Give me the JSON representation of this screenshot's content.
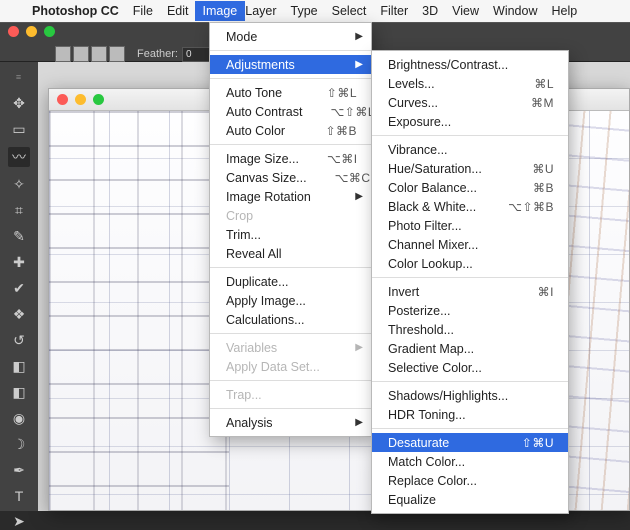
{
  "menubar": {
    "app_name": "Photoshop CC",
    "items": [
      "File",
      "Edit",
      "Image",
      "Layer",
      "Type",
      "Select",
      "Filter",
      "3D",
      "View",
      "Window",
      "Help"
    ],
    "open_index": 2
  },
  "options_bar": {
    "feather_label": "Feather:",
    "feather_value": "0"
  },
  "toolbox": {
    "tools": [
      {
        "name": "move-tool",
        "glyph": "✥"
      },
      {
        "name": "marquee-tool",
        "glyph": "▭"
      },
      {
        "name": "lasso-tool",
        "glyph": "〰",
        "selected": true
      },
      {
        "name": "magic-wand-tool",
        "glyph": "✧"
      },
      {
        "name": "crop-tool",
        "glyph": "⌗"
      },
      {
        "name": "eyedropper-tool",
        "glyph": "✎"
      },
      {
        "name": "healing-brush-tool",
        "glyph": "✚"
      },
      {
        "name": "brush-tool",
        "glyph": "✔"
      },
      {
        "name": "clone-stamp-tool",
        "glyph": "❖"
      },
      {
        "name": "history-brush-tool",
        "glyph": "↺"
      },
      {
        "name": "eraser-tool",
        "glyph": "◧"
      },
      {
        "name": "gradient-tool",
        "glyph": "◧"
      },
      {
        "name": "blur-tool",
        "glyph": "◉"
      },
      {
        "name": "dodge-tool",
        "glyph": "☽"
      },
      {
        "name": "pen-tool",
        "glyph": "✒"
      },
      {
        "name": "type-tool",
        "glyph": "T"
      },
      {
        "name": "path-select-tool",
        "glyph": "➤"
      }
    ]
  },
  "document": {
    "title": ""
  },
  "image_menu": [
    {
      "label": "Mode",
      "arrow": true
    },
    {
      "sep": true
    },
    {
      "label": "Adjustments",
      "arrow": true,
      "highlight": true
    },
    {
      "sep": true
    },
    {
      "label": "Auto Tone",
      "shortcut": "⇧⌘L"
    },
    {
      "label": "Auto Contrast",
      "shortcut": "⌥⇧⌘L"
    },
    {
      "label": "Auto Color",
      "shortcut": "⇧⌘B"
    },
    {
      "sep": true
    },
    {
      "label": "Image Size...",
      "shortcut": "⌥⌘I"
    },
    {
      "label": "Canvas Size...",
      "shortcut": "⌥⌘C"
    },
    {
      "label": "Image Rotation",
      "arrow": true
    },
    {
      "label": "Crop",
      "disabled": true
    },
    {
      "label": "Trim..."
    },
    {
      "label": "Reveal All"
    },
    {
      "sep": true
    },
    {
      "label": "Duplicate..."
    },
    {
      "label": "Apply Image..."
    },
    {
      "label": "Calculations..."
    },
    {
      "sep": true
    },
    {
      "label": "Variables",
      "arrow": true,
      "disabled": true
    },
    {
      "label": "Apply Data Set...",
      "disabled": true
    },
    {
      "sep": true
    },
    {
      "label": "Trap...",
      "disabled": true
    },
    {
      "sep": true
    },
    {
      "label": "Analysis",
      "arrow": true
    }
  ],
  "adjustments_menu": [
    {
      "label": "Brightness/Contrast..."
    },
    {
      "label": "Levels...",
      "shortcut": "⌘L"
    },
    {
      "label": "Curves...",
      "shortcut": "⌘M"
    },
    {
      "label": "Exposure..."
    },
    {
      "sep": true
    },
    {
      "label": "Vibrance..."
    },
    {
      "label": "Hue/Saturation...",
      "shortcut": "⌘U"
    },
    {
      "label": "Color Balance...",
      "shortcut": "⌘B"
    },
    {
      "label": "Black & White...",
      "shortcut": "⌥⇧⌘B"
    },
    {
      "label": "Photo Filter..."
    },
    {
      "label": "Channel Mixer..."
    },
    {
      "label": "Color Lookup..."
    },
    {
      "sep": true
    },
    {
      "label": "Invert",
      "shortcut": "⌘I"
    },
    {
      "label": "Posterize..."
    },
    {
      "label": "Threshold..."
    },
    {
      "label": "Gradient Map..."
    },
    {
      "label": "Selective Color..."
    },
    {
      "sep": true
    },
    {
      "label": "Shadows/Highlights..."
    },
    {
      "label": "HDR Toning..."
    },
    {
      "sep": true
    },
    {
      "label": "Desaturate",
      "shortcut": "⇧⌘U",
      "highlight": true
    },
    {
      "label": "Match Color..."
    },
    {
      "label": "Replace Color..."
    },
    {
      "label": "Equalize"
    }
  ]
}
